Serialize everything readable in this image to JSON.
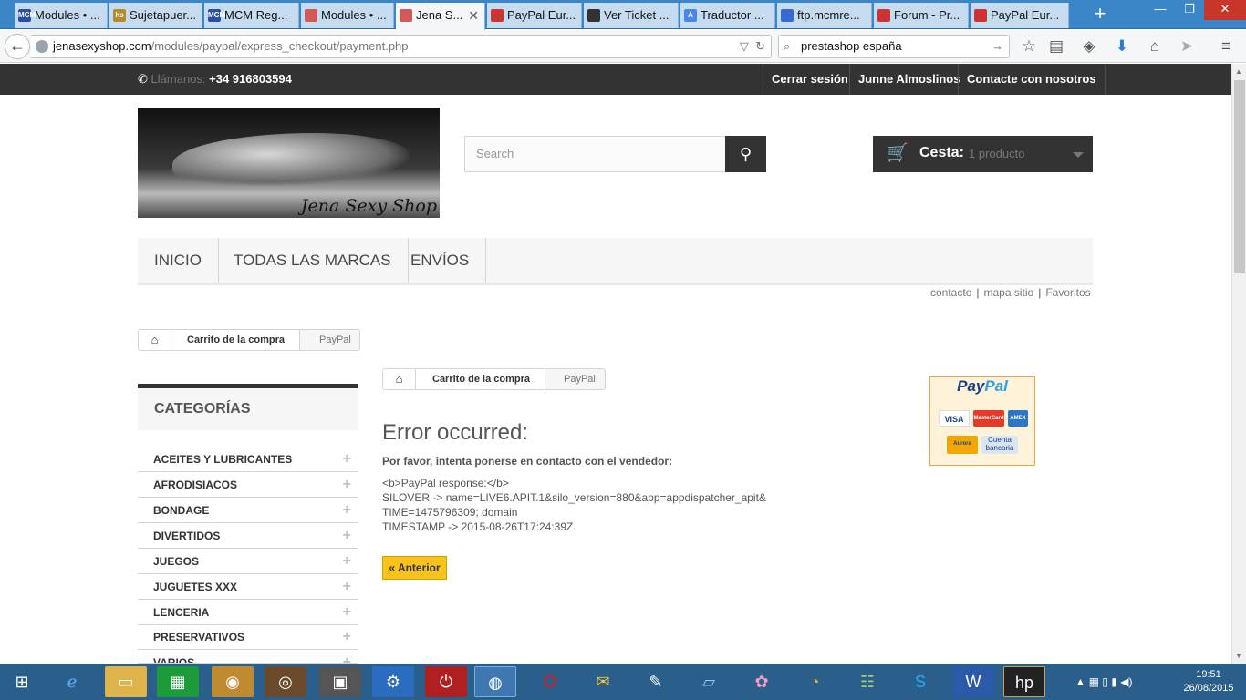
{
  "browser": {
    "tabs": [
      {
        "label": "Modules • ...",
        "fav": "MCM",
        "color": "#2b4fa8",
        "active": false
      },
      {
        "label": "Sujetapuer...",
        "fav": "hs",
        "color": "#b68a2a",
        "active": false
      },
      {
        "label": "MCM Reg...",
        "fav": "MCM",
        "color": "#2b4fa8",
        "active": false
      },
      {
        "label": "Modules • ...",
        "fav": "",
        "color": "#d05a5a",
        "active": false
      },
      {
        "label": "Jena S...",
        "fav": "",
        "color": "#d05a5a",
        "active": true
      },
      {
        "label": "PayPal Eur...",
        "fav": "",
        "color": "#cc3333",
        "active": false
      },
      {
        "label": "Ver Ticket ...",
        "fav": "",
        "color": "#333333",
        "active": false
      },
      {
        "label": "Traductor ...",
        "fav": "A",
        "color": "#4a86e8",
        "active": false
      },
      {
        "label": "ftp.mcmre...",
        "fav": "",
        "color": "#3a6ad0",
        "active": false
      },
      {
        "label": "Forum - Pr...",
        "fav": "",
        "color": "#cc3333",
        "active": false
      },
      {
        "label": "PayPal Eur...",
        "fav": "",
        "color": "#cc3333",
        "active": false
      }
    ],
    "url_domain": "jenasexyshop.com",
    "url_path": "/modules/paypal/express_checkout/payment.php",
    "search_value": "prestashop españa"
  },
  "header": {
    "phone_label": "Llámanos:",
    "phone_number": "+34 916803594",
    "links": [
      "Cerrar sesión",
      "Junne Almoslinos",
      "Contacte con nosotros"
    ],
    "logo_text": "Jena Sexy Shop",
    "search_placeholder": "Search",
    "cart_label": "Cesta:",
    "cart_count": "1 producto"
  },
  "menu": [
    "INICIO",
    "TODAS LAS MARCAS",
    "ENVÍOS"
  ],
  "sublinks": [
    "contacto",
    "mapa sitio",
    "Favoritos"
  ],
  "breadcrumb": {
    "cart": "Carrito de la compra",
    "current": "PayPal"
  },
  "categories": {
    "title": "CATEGORÍAS",
    "items": [
      "ACEITES Y LUBRICANTES",
      "AFRODISIACOS",
      "BONDAGE",
      "DIVERTIDOS",
      "JUEGOS",
      "JUGUETES XXX",
      "LENCERIA",
      "PRESERVATIVOS",
      "VARIOS"
    ]
  },
  "error": {
    "title": "Error occurred:",
    "subtitle": "Por favor, intenta ponerse en contacto con el vendedor:",
    "lines": [
      "<b>PayPal response:</b>",
      "SILOVER -> name=LIVE6.APIT.1&silo_version=880&app=appdispatcher_apit&",
      "TIME=1475796309; domain",
      "TIMESTAMP -> 2015-08-26T17:24:39Z"
    ],
    "back_button": "« Anterior"
  },
  "paypal_logo": {
    "title_a": "Pay",
    "title_b": "Pal",
    "cards": [
      "VISA",
      "MasterCard",
      "AMEX",
      "Aurora",
      "Cuenta bancaria"
    ]
  },
  "taskbar": {
    "time": "19:51",
    "date": "26/08/2015"
  }
}
